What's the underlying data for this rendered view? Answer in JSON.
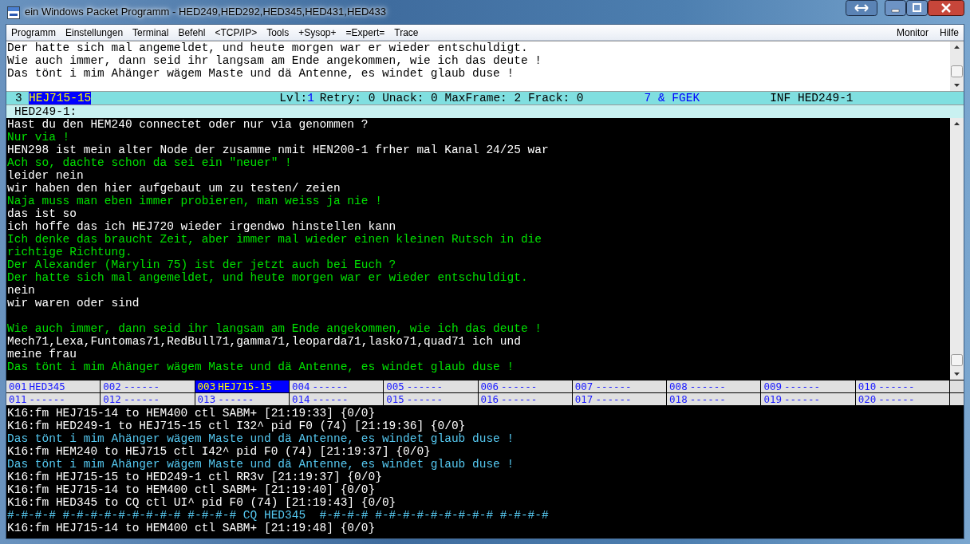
{
  "window": {
    "title": "ein Windows Packet Programm - HED249,HED292,HED345,HED431,HED433"
  },
  "menu": {
    "items": [
      "Programm",
      "Einstellungen",
      "Terminal",
      "Befehl",
      "<TCP/IP>",
      "Tools",
      "+Sysop+",
      "=Expert=",
      "Trace"
    ],
    "right_items": [
      "Monitor",
      "Hilfe"
    ]
  },
  "input_area": {
    "lines": [
      "Der hatte sich mal angemeldet, und heute morgen war er wieder entschuldigt.",
      "Wie auch immer, dann seid ihr langsam am Ende angekommen, wie ich das deute !",
      "Das tönt i mim Ahänger wägem Maste und dä Antenne, es windet glaub duse !"
    ]
  },
  "status_bar": {
    "channel": "3",
    "call": "HEJ715-15",
    "level_label": "Lvl:",
    "level_value": "1",
    "counters": "Retry: 0 Unack: 0 MaxFrame: 2 Frack: 0",
    "link": "7 & FGEK",
    "info": "INF HED249-1"
  },
  "connection_header": "HED249-1:",
  "terminal": {
    "lines": [
      {
        "kind": "received",
        "text": "Hast du den HEM240 connectet oder nur via genommen ?"
      },
      {
        "kind": "sent",
        "text": "Nur via !"
      },
      {
        "kind": "received",
        "text": "HEN298 ist mein alter Node der zusamme nmit HEN200-1 frher mal Kanal 24/25 war"
      },
      {
        "kind": "sent",
        "text": "Ach so, dachte schon da sei ein \"neuer\" !"
      },
      {
        "kind": "received",
        "text": "leider nein"
      },
      {
        "kind": "received",
        "text": "wir haben den hier aufgebaut um zu testen/ zeien"
      },
      {
        "kind": "sent",
        "text": "Naja muss man eben immer probieren, man weiss ja nie !"
      },
      {
        "kind": "received",
        "text": "das ist so"
      },
      {
        "kind": "received",
        "text": "ich hoffe das ich HEJ720 wieder irgendwo hinstellen kann"
      },
      {
        "kind": "sent",
        "text": "Ich denke das braucht Zeit, aber immer mal wieder einen kleinen Rutsch in die"
      },
      {
        "kind": "sent",
        "text": "richtige Richtung."
      },
      {
        "kind": "sent",
        "text": "Der Alexander (Marylin 75) ist der jetzt auch bei Euch ?"
      },
      {
        "kind": "sent",
        "text": "Der hatte sich mal angemeldet, und heute morgen war er wieder entschuldigt."
      },
      {
        "kind": "received",
        "text": "nein"
      },
      {
        "kind": "received",
        "text": "wir waren oder sind"
      },
      {
        "kind": "blank"
      },
      {
        "kind": "sent",
        "text": "Wie auch immer, dann seid ihr langsam am Ende angekommen, wie ich das deute !"
      },
      {
        "kind": "received",
        "text": "Mech71,Lexa,Funtomas71,RedBull71,gamma71,leoparda71,lasko71,quad71 ich und"
      },
      {
        "kind": "received",
        "text": "meine frau"
      },
      {
        "kind": "sent",
        "text": "Das tönt i mim Ahänger wägem Maste und dä Antenne, es windet glaub duse !"
      }
    ]
  },
  "channels": [
    {
      "number": "001",
      "call": "HED345",
      "selected": false
    },
    {
      "number": "002",
      "call": "------",
      "selected": false
    },
    {
      "number": "003",
      "call": "HEJ715-15",
      "selected": true
    },
    {
      "number": "004",
      "call": "------",
      "selected": false
    },
    {
      "number": "005",
      "call": "------",
      "selected": false
    },
    {
      "number": "006",
      "call": "------",
      "selected": false
    },
    {
      "number": "007",
      "call": "------",
      "selected": false
    },
    {
      "number": "008",
      "call": "------",
      "selected": false
    },
    {
      "number": "009",
      "call": "------",
      "selected": false
    },
    {
      "number": "010",
      "call": "------",
      "selected": false
    },
    {
      "number": "011",
      "call": "------",
      "selected": false
    },
    {
      "number": "012",
      "call": "------",
      "selected": false
    },
    {
      "number": "013",
      "call": "------",
      "selected": false
    },
    {
      "number": "014",
      "call": "------",
      "selected": false
    },
    {
      "number": "015",
      "call": "------",
      "selected": false
    },
    {
      "number": "016",
      "call": "------",
      "selected": false
    },
    {
      "number": "017",
      "call": "------",
      "selected": false
    },
    {
      "number": "018",
      "call": "------",
      "selected": false
    },
    {
      "number": "019",
      "call": "------",
      "selected": false
    },
    {
      "number": "020",
      "call": "------",
      "selected": false
    }
  ],
  "monitor": {
    "lines": [
      {
        "kind": "header",
        "text": "K16:fm HEJ715-14 to HEM400 ctl SABM+ [21:19:33] {0/0}"
      },
      {
        "kind": "header",
        "text": "K16:fm HED249-1 to HEJ715-15 ctl I32^ pid F0 (74) [21:19:36] {0/0}"
      },
      {
        "kind": "info",
        "text": "Das tönt i mim Ahänger wägem Maste und dä Antenne, es windet glaub duse !"
      },
      {
        "kind": "header",
        "text": "K16:fm HEM240 to HEJ715 ctl I42^ pid F0 (74) [21:19:37] {0/0}"
      },
      {
        "kind": "info",
        "text": "Das tönt i mim Ahänger wägem Maste und dä Antenne, es windet glaub duse !"
      },
      {
        "kind": "header",
        "text": "K16:fm HEJ715-15 to HED249-1 ctl RR3v [21:19:37] {0/0}"
      },
      {
        "kind": "header",
        "text": "K16:fm HEJ715-14 to HEM400 ctl SABM+ [21:19:40] {0/0}"
      },
      {
        "kind": "header",
        "text": "K16:fm HED345 to CQ ctl UI^ pid F0 (74) [21:19:43] {0/0}"
      },
      {
        "kind": "info",
        "text": "#-#-#-# #-#-#-#-#-#-#-#-# #-#-#-# CQ HED345  #-#-#-# #-#-#-#-#-#-#-#-# #-#-#-#"
      },
      {
        "kind": "header",
        "text": "K16:fm HEJ715-14 to HEM400 ctl SABM+ [21:19:48] {0/0}"
      }
    ]
  }
}
